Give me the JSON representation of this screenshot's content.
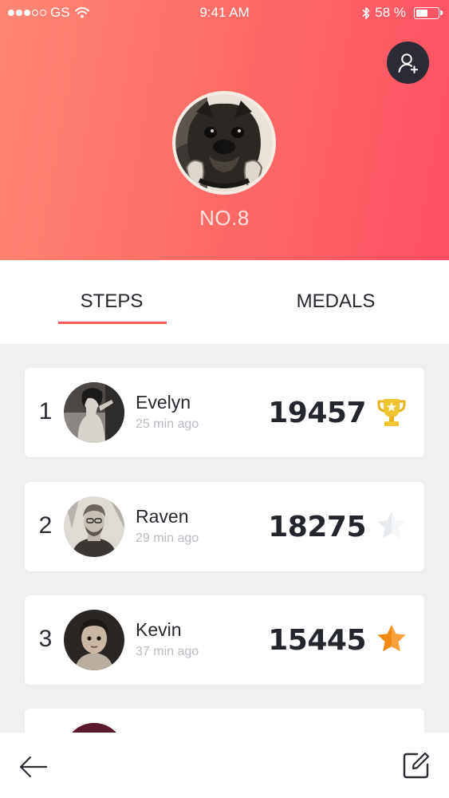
{
  "status_bar": {
    "carrier": "GS",
    "time": "9:41 AM",
    "battery": "58 %",
    "battery_level": 0.58,
    "signal_bars_filled": 3,
    "signal_bars_total": 5
  },
  "profile": {
    "rank_label": "NO.8",
    "add_user_icon": "add-user-icon"
  },
  "tabs": [
    {
      "label": "STEPS",
      "active": true
    },
    {
      "label": "MEDALS",
      "active": false
    }
  ],
  "leaderboard": [
    {
      "rank": "1",
      "name": "Evelyn",
      "time": "25 min ago",
      "steps": "19457",
      "award": "gold-trophy"
    },
    {
      "rank": "2",
      "name": "Raven",
      "time": "29 min ago",
      "steps": "18275",
      "award": "silver-star"
    },
    {
      "rank": "3",
      "name": "Kevin",
      "time": "37 min ago",
      "steps": "15445",
      "award": "bronze-star"
    }
  ],
  "colors": {
    "header_start": "#ff8773",
    "header_end": "#fe4f63",
    "accent": "#f55a5f",
    "gold": "#f1c232",
    "silver": "#e3e6ea",
    "bronze": "#f4901e"
  },
  "bottom_bar": {
    "back_icon": "arrow-left-icon",
    "edit_icon": "edit-icon"
  }
}
